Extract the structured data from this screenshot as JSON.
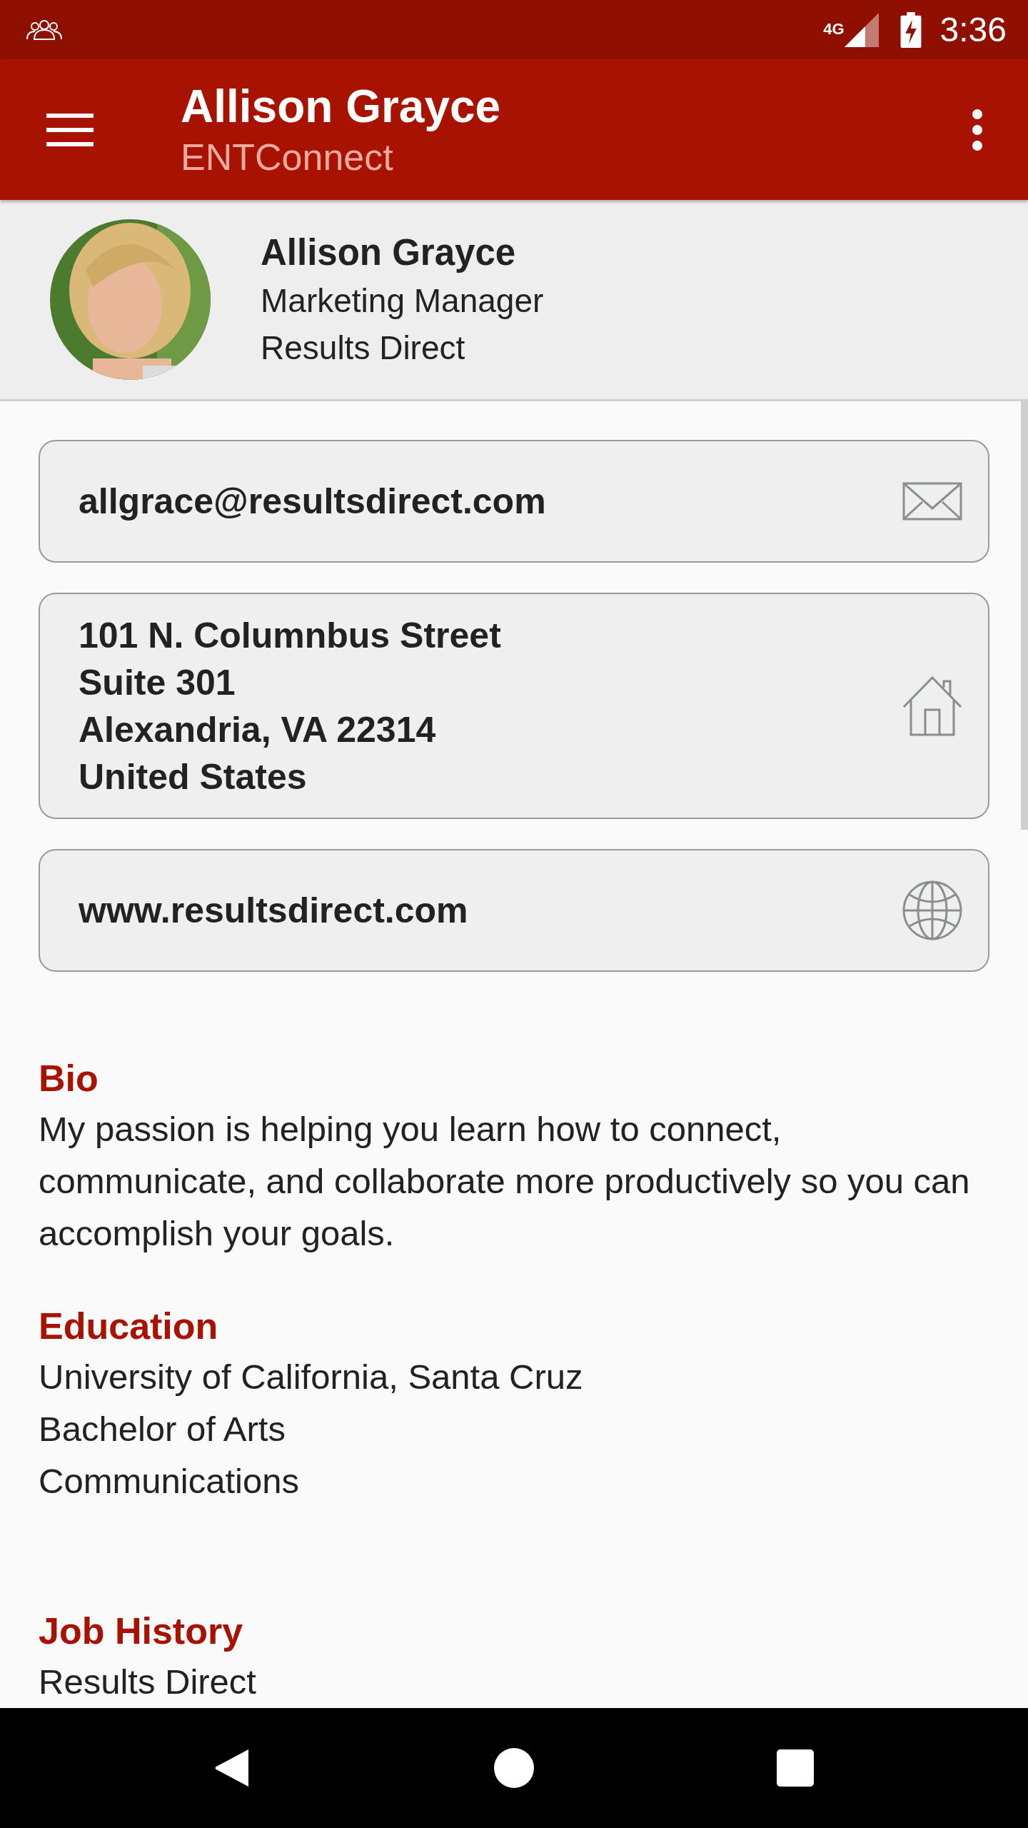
{
  "status_bar": {
    "network": "4G",
    "time": "3:36"
  },
  "app_bar": {
    "title": "Allison Grayce",
    "subtitle": "ENTConnect"
  },
  "profile": {
    "name": "Allison Grayce",
    "job_title": "Marketing Manager",
    "company": "Results Direct"
  },
  "contact_cards": [
    {
      "kind": "email",
      "lines": [
        "allgrace@resultsdirect.com"
      ]
    },
    {
      "kind": "address",
      "lines": [
        "101 N. Columnbus Street",
        "Suite 301",
        "Alexandria, VA 22314",
        "United States"
      ]
    },
    {
      "kind": "website",
      "lines": [
        "www.resultsdirect.com"
      ]
    }
  ],
  "sections": [
    {
      "heading": "Bio",
      "paragraph": "My passion is helping you learn how to connect, communicate, and collaborate more productively so you can accomplish your goals."
    },
    {
      "heading": "Education",
      "lines": [
        "University of California, Santa Cruz",
        "Bachelor of Arts",
        "Communications"
      ]
    },
    {
      "heading": "Job History",
      "lines": [
        "Results Direct"
      ]
    }
  ]
}
